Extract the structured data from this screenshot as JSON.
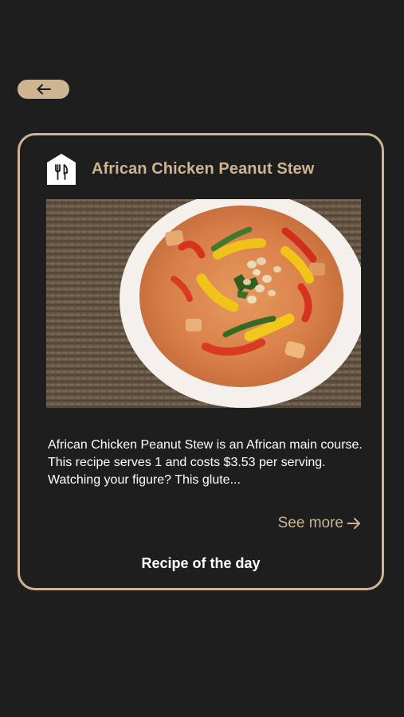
{
  "nav": {
    "back_icon": "arrow-left-icon"
  },
  "card": {
    "logo_icon": "fork-knife-house-icon",
    "title": "African Chicken Peanut Stew",
    "image_subject": "bowl of peanut stew with peppers and peanuts",
    "description": "African Chicken Peanut Stew is an African main course. This recipe serves 1 and costs $3.53 per serving. Watching your figure? This glute...",
    "see_more_label": "See more",
    "see_more_icon": "arrow-right-icon",
    "footer_label": "Recipe of the day"
  },
  "colors": {
    "background": "#1e1e1e",
    "accent": "#cdb592",
    "text": "#ffffff"
  }
}
